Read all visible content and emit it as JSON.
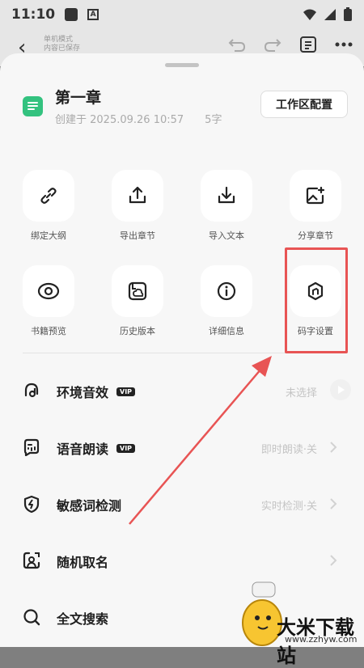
{
  "status_bar": {
    "time": "11:10",
    "a_badge": "A"
  },
  "editor": {
    "mode_line1": "单机模式",
    "mode_line2": "内容已保存"
  },
  "sheet": {
    "doc_title": "第一章",
    "created": "创建于 2025.09.26 10:57",
    "word_count": "5字",
    "workspace_button": "工作区配置"
  },
  "grid": [
    {
      "label": "绑定大纲",
      "icon": "link-icon"
    },
    {
      "label": "导出章节",
      "icon": "export-icon"
    },
    {
      "label": "导入文本",
      "icon": "import-icon"
    },
    {
      "label": "分享章节",
      "icon": "share-image-icon"
    },
    {
      "label": "书籍预览",
      "icon": "eye-icon"
    },
    {
      "label": "历史版本",
      "icon": "history-icon"
    },
    {
      "label": "详细信息",
      "icon": "info-icon"
    },
    {
      "label": "码字设置",
      "icon": "settings-hex-icon"
    }
  ],
  "rows": [
    {
      "label": "环境音效",
      "vip": "VIP",
      "value": "未选择",
      "icon": "ambient-sound-icon"
    },
    {
      "label": "语音朗读",
      "vip": "VIP",
      "value": "即时朗读·关",
      "icon": "voice-read-icon"
    },
    {
      "label": "敏感词检测",
      "value": "实时检测·关",
      "icon": "shield-bolt-icon"
    },
    {
      "label": "随机取名",
      "value": "",
      "icon": "random-name-icon"
    },
    {
      "label": "全文搜索",
      "value": "",
      "icon": "search-icon"
    }
  ],
  "watermark": {
    "text": "大米下载站",
    "url": "www.zzhyw.com"
  },
  "colors": {
    "accent_green": "#33c27f",
    "annotation_red": "#e85454"
  }
}
